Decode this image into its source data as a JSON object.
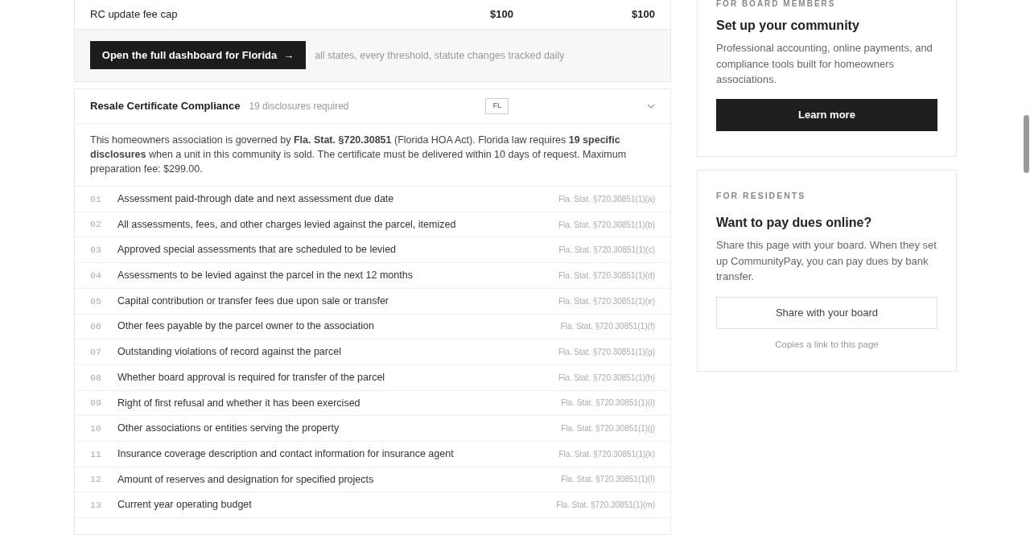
{
  "fee_row": {
    "label": "RC update fee cap",
    "value_1": "$100",
    "value_2": "$100"
  },
  "dashboard_cta": {
    "button": "Open the full dashboard for Florida",
    "arrow": "→",
    "note": "all states, every threshold, statute changes tracked daily"
  },
  "compliance": {
    "title": "Resale Certificate Compliance",
    "count": "19 disclosures required",
    "state_badge": "FL",
    "expanded": true,
    "intro": "This homeowners association is governed by **Fla. Stat. §720.30851** (Florida HOA Act). Florida law requires **19 specific disclosures** when a unit in this community is sold. The certificate must be delivered within 10 days of request. Maximum preparation fee: $299.00.",
    "disclosures": [
      {
        "number": "01",
        "text": "Assessment paid-through date and next assessment due date",
        "citation": "Fla. Stat. §720.30851(1)(a)"
      },
      {
        "number": "02",
        "text": "All assessments, fees, and other charges levied against the parcel, itemized",
        "citation": "Fla. Stat. §720.30851(1)(b)"
      },
      {
        "number": "03",
        "text": "Approved special assessments that are scheduled to be levied",
        "citation": "Fla. Stat. §720.30851(1)(c)"
      },
      {
        "number": "04",
        "text": "Assessments to be levied against the parcel in the next 12 months",
        "citation": "Fla. Stat. §720.30851(1)(d)"
      },
      {
        "number": "05",
        "text": "Capital contribution or transfer fees due upon sale or transfer",
        "citation": "Fla. Stat. §720.30851(1)(e)"
      },
      {
        "number": "06",
        "text": "Other fees payable by the parcel owner to the association",
        "citation": "Fla. Stat. §720.30851(1)(f)"
      },
      {
        "number": "07",
        "text": "Outstanding violations of record against the parcel",
        "citation": "Fla. Stat. §720.30851(1)(g)"
      },
      {
        "number": "08",
        "text": "Whether board approval is required for transfer of the parcel",
        "citation": "Fla. Stat. §720.30851(1)(h)"
      },
      {
        "number": "09",
        "text": "Right of first refusal and whether it has been exercised",
        "citation": "Fla. Stat. §720.30851(1)(i)"
      },
      {
        "number": "10",
        "text": "Other associations or entities serving the property",
        "citation": "Fla. Stat. §720.30851(1)(j)"
      },
      {
        "number": "11",
        "text": "Insurance coverage description and contact information for insurance agent",
        "citation": "Fla. Stat. §720.30851(1)(k)"
      },
      {
        "number": "12",
        "text": "Amount of reserves and designation for specified projects",
        "citation": "Fla. Stat. §720.30851(1)(l)"
      },
      {
        "number": "13",
        "text": "Current year operating budget",
        "citation": "Fla. Stat. §720.30851(1)(m)"
      }
    ]
  },
  "board_card": {
    "eyebrow": "FOR BOARD MEMBERS",
    "title": "Set up your community",
    "body": "Professional accounting, online payments, and compliance tools built for homeowners associations.",
    "button": "Learn more"
  },
  "residents_card": {
    "eyebrow": "FOR RESIDENTS",
    "title": "Want to pay dues online?",
    "body": "Share this page with your board. When they set up CommunityPay, you can pay dues by bank transfer.",
    "button": "Share with your board",
    "hint": "Copies a link to this page"
  }
}
